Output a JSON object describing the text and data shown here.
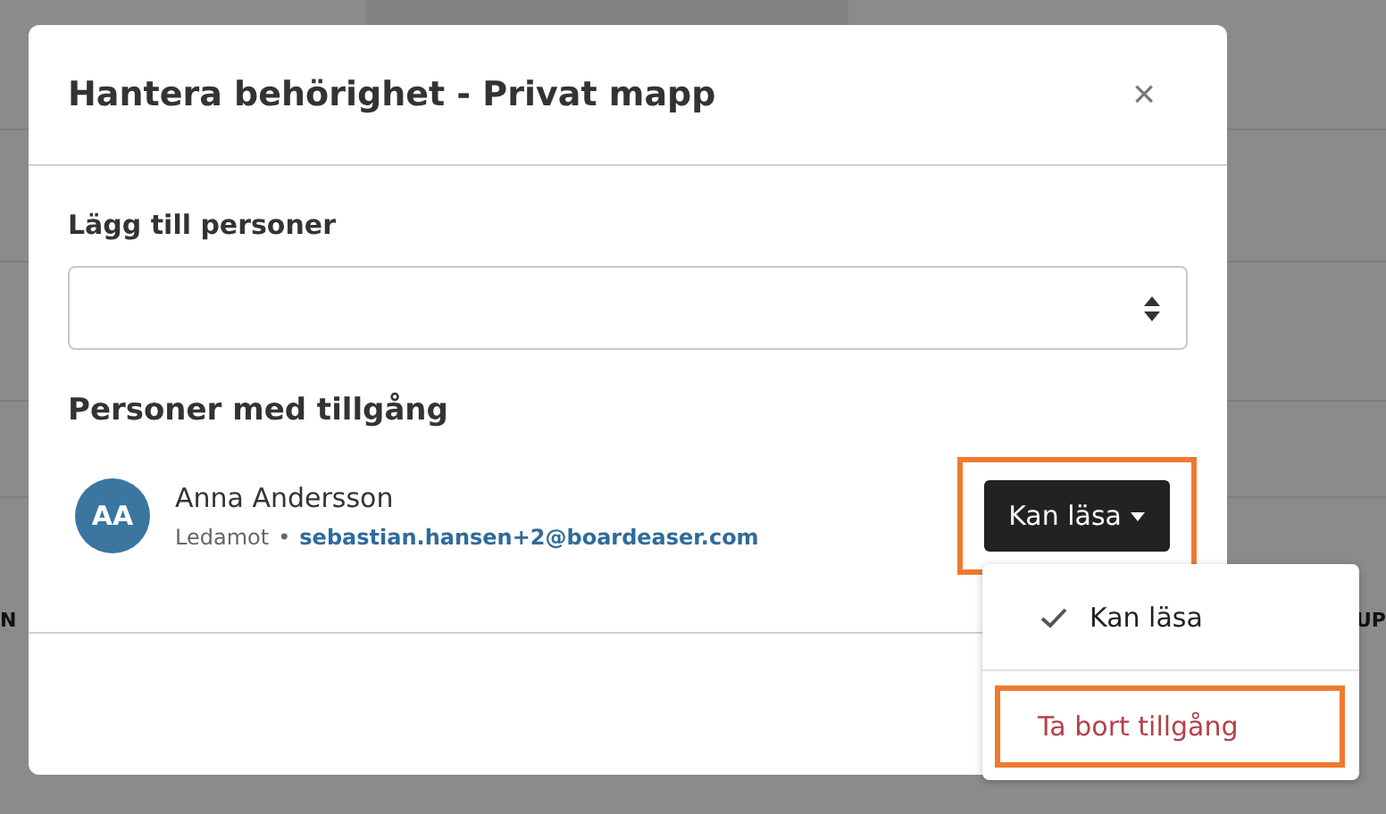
{
  "background": {
    "texts": [
      "N",
      "UP"
    ]
  },
  "dialog": {
    "title": "Hantera behörighet - Privat mapp",
    "close": "×",
    "add_label": "Lägg till personer",
    "section_title": "Personer med tillgång",
    "people": [
      {
        "initials": "AA",
        "name": "Anna Andersson",
        "role": "Ledamot",
        "separator": "•",
        "email": "sebastian.hansen+2@boardeaser.com",
        "permission": "Kan läsa",
        "highlighted": true
      }
    ]
  },
  "menu": {
    "items": [
      {
        "kind": "option",
        "label": "Kan läsa",
        "checked": true,
        "highlighted": false
      },
      {
        "kind": "danger",
        "label": "Ta bort tillgång",
        "checked": false,
        "highlighted": true
      }
    ]
  }
}
